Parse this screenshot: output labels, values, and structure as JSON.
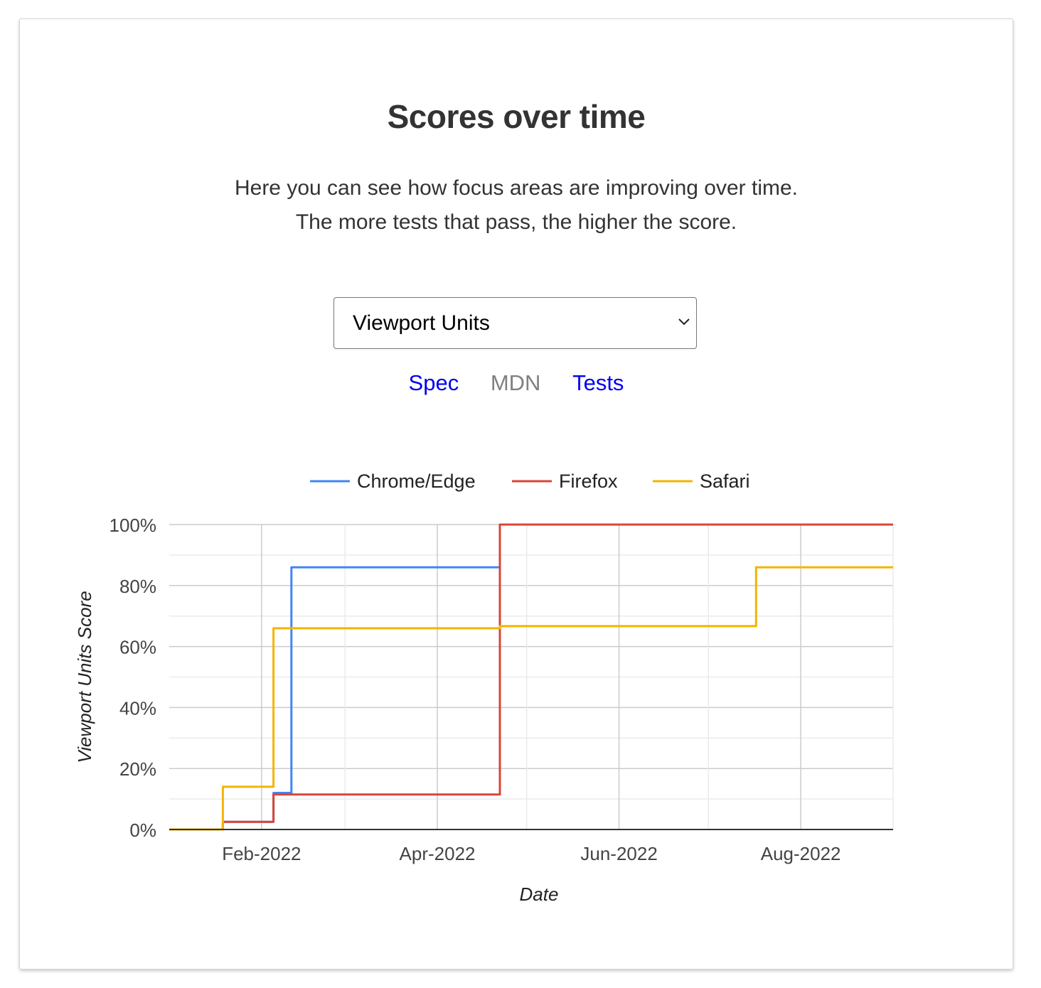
{
  "section": {
    "title": "Scores over time",
    "description": "Here you can see how focus areas are improving over time. The more tests that pass, the higher the score."
  },
  "focus_select": {
    "selected": "Viewport Units"
  },
  "links": {
    "spec": "Spec",
    "mdn": "MDN",
    "tests": "Tests"
  },
  "colors": {
    "chrome": "#4285f4",
    "firefox": "#db4437",
    "safari": "#f4b400",
    "active_link": "#0000ee",
    "disabled_link": "#808080"
  },
  "chart_data": {
    "type": "line",
    "step": true,
    "title": "",
    "xlabel": "Date",
    "ylabel": "Viewport Units Score",
    "xlim": [
      "2022-01-01",
      "2022-09-01"
    ],
    "ylim": [
      0,
      100
    ],
    "y_ticks": [
      0,
      20,
      40,
      60,
      80,
      100
    ],
    "y_tick_labels": [
      "0%",
      "20%",
      "40%",
      "60%",
      "80%",
      "100%"
    ],
    "x_ticks": [
      "2022-02-01",
      "2022-04-01",
      "2022-06-01",
      "2022-08-01"
    ],
    "x_tick_labels": [
      "Feb-2022",
      "Apr-2022",
      "Jun-2022",
      "Aug-2022"
    ],
    "grid": true,
    "legend_position": "top",
    "series": [
      {
        "name": "Chrome/Edge",
        "color": "#4285f4",
        "points": [
          [
            "2022-01-01",
            0
          ],
          [
            "2022-01-19",
            0
          ],
          [
            "2022-01-19",
            2.5
          ],
          [
            "2022-02-05",
            2.5
          ],
          [
            "2022-02-05",
            12
          ],
          [
            "2022-02-11",
            12
          ],
          [
            "2022-02-11",
            86
          ],
          [
            "2022-04-22",
            86
          ],
          [
            "2022-04-22",
            100
          ],
          [
            "2022-09-01",
            100
          ]
        ]
      },
      {
        "name": "Firefox",
        "color": "#db4437",
        "points": [
          [
            "2022-01-01",
            0
          ],
          [
            "2022-01-19",
            0
          ],
          [
            "2022-01-19",
            2.5
          ],
          [
            "2022-02-05",
            2.5
          ],
          [
            "2022-02-05",
            11.5
          ],
          [
            "2022-04-22",
            11.5
          ],
          [
            "2022-04-22",
            100
          ],
          [
            "2022-09-01",
            100
          ]
        ]
      },
      {
        "name": "Safari",
        "color": "#f4b400",
        "points": [
          [
            "2022-01-01",
            0
          ],
          [
            "2022-01-19",
            0
          ],
          [
            "2022-01-19",
            14
          ],
          [
            "2022-02-05",
            14
          ],
          [
            "2022-02-05",
            66
          ],
          [
            "2022-04-22",
            66
          ],
          [
            "2022-04-22",
            66.7
          ],
          [
            "2022-07-17",
            66.7
          ],
          [
            "2022-07-17",
            86
          ],
          [
            "2022-09-01",
            86
          ]
        ]
      }
    ]
  }
}
